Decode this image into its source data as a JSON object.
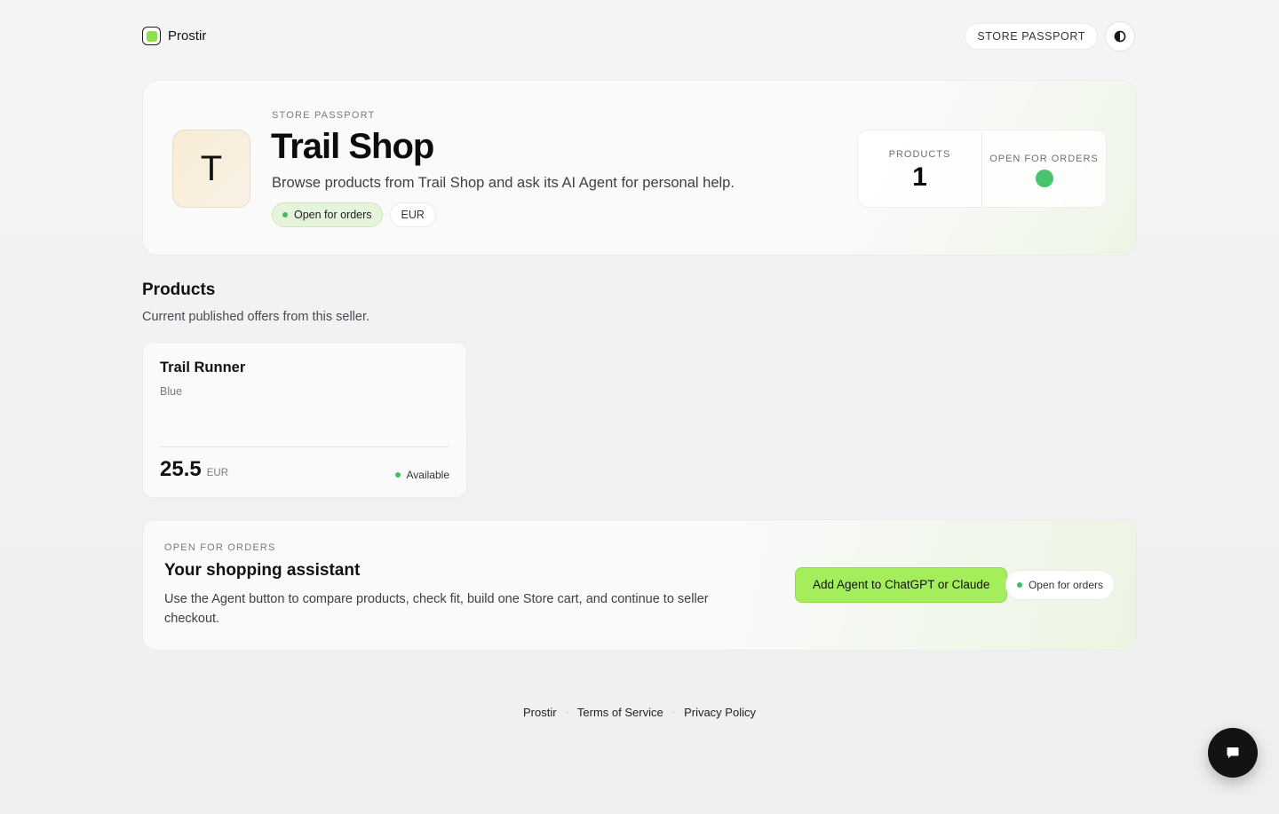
{
  "header": {
    "brand_name": "Prostir",
    "nav_pill": "STORE PASSPORT",
    "theme_toggle_icon": "contrast-icon"
  },
  "store": {
    "kicker": "STORE PASSPORT",
    "initial": "T",
    "name": "Trail Shop",
    "description": "Browse products from Trail Shop and ask its AI Agent for personal help.",
    "status_badge": "Open for orders",
    "currency_badge": "EUR",
    "stats": {
      "products_label": "PRODUCTS",
      "products_value": "1",
      "open_label": "OPEN FOR ORDERS"
    }
  },
  "products_section": {
    "title": "Products",
    "subtitle": "Current published offers from this seller.",
    "items": [
      {
        "name": "Trail Runner",
        "variant": "Blue",
        "price": "25.5",
        "currency": "EUR",
        "availability": "Available"
      }
    ]
  },
  "assistant": {
    "kicker": "OPEN FOR ORDERS",
    "title": "Your shopping assistant",
    "description": "Use the Agent button to compare products, check fit, build one Store cart, and continue to seller checkout.",
    "cta_label": "Add Agent to ChatGPT or Claude",
    "status_badge": "Open for orders"
  },
  "footer": {
    "links": [
      "Prostir",
      "Terms of Service",
      "Privacy Policy"
    ],
    "separator": "·"
  },
  "chat": {
    "icon": "chat-bubble-icon"
  },
  "colors": {
    "accent_green": "#a4ee5b",
    "status_green": "#49c46d",
    "background": "#f2f2f4"
  }
}
